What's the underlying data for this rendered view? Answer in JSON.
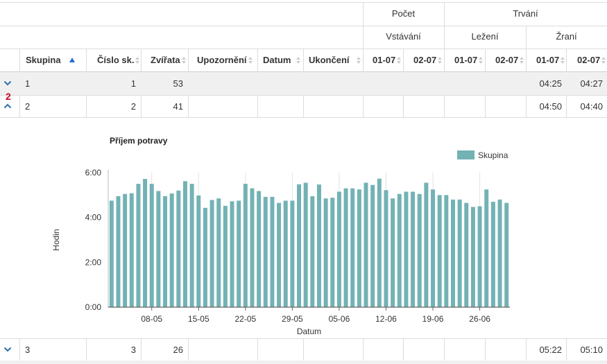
{
  "header": {
    "groups_top": [
      {
        "label": "Počet"
      },
      {
        "label": "Trvání"
      }
    ],
    "groups_sub": [
      {
        "label": "Vstávání"
      },
      {
        "label": "Ležení"
      },
      {
        "label": "Žraní"
      }
    ],
    "columns": [
      {
        "label": "Skupina"
      },
      {
        "label": "Číslo sk."
      },
      {
        "label": "Zvířata"
      },
      {
        "label": "Upozornění"
      },
      {
        "label": "Datum"
      },
      {
        "label": "Ukončení"
      },
      {
        "label": "01-07"
      },
      {
        "label": "02-07"
      },
      {
        "label": "01-07"
      },
      {
        "label": "02-07"
      },
      {
        "label": "01-07"
      },
      {
        "label": "02-07"
      }
    ]
  },
  "rows": [
    {
      "skupina": "1",
      "cislo": "1",
      "zvirata": "53",
      "zrani_0107": "04:25",
      "zrani_0207": "04:27"
    },
    {
      "skupina": "2",
      "cislo": "2",
      "zvirata": "41",
      "zrani_0107": "04:50",
      "zrani_0207": "04:40",
      "badge": "2"
    },
    {
      "skupina": "3",
      "cislo": "3",
      "zvirata": "26",
      "zrani_0107": "05:22",
      "zrani_0207": "05:10"
    }
  ],
  "icons": {
    "row_expand": "chevron-down-icon",
    "row_collapse": "chevron-up-icon",
    "sort_asc": "sort-ascending-icon",
    "sort": "sort-icon"
  },
  "colors": {
    "bar": "#73b2b4",
    "accent": "#2f6ea8",
    "badge": "#d0021b"
  },
  "chart_data": {
    "type": "bar",
    "title": "Příjem potravy",
    "xlabel": "Datum",
    "ylabel": "Hodin",
    "ylim": [
      0,
      6
    ],
    "yticks": [
      "0:00",
      "2:00",
      "4:00",
      "6:00"
    ],
    "xticks": [
      "08-05",
      "15-05",
      "22-05",
      "29-05",
      "05-06",
      "12-06",
      "19-06",
      "26-06"
    ],
    "legend": "top-right",
    "grid": "x",
    "series": [
      {
        "name": "Skupina",
        "values": [
          4.75,
          4.95,
          5.05,
          5.08,
          5.5,
          5.72,
          5.5,
          5.18,
          4.95,
          5.07,
          5.2,
          5.62,
          5.5,
          4.98,
          4.43,
          4.78,
          4.85,
          4.52,
          4.72,
          4.75,
          5.5,
          5.3,
          5.18,
          4.92,
          4.92,
          4.65,
          4.75,
          4.75,
          5.48,
          5.55,
          4.95,
          5.47,
          4.85,
          4.88,
          5.15,
          5.3,
          5.3,
          5.25,
          5.55,
          5.45,
          5.73,
          5.22,
          4.85,
          5.05,
          5.15,
          5.15,
          5.05,
          5.55,
          5.25,
          5.0,
          5.0,
          4.8,
          4.8,
          4.65,
          4.47,
          4.5,
          5.25,
          4.7,
          4.8,
          4.65
        ]
      }
    ]
  }
}
